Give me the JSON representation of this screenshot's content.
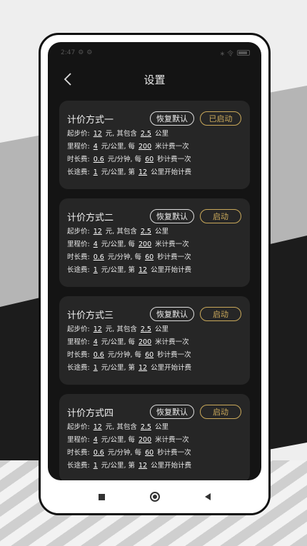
{
  "status": {
    "time": "2:47",
    "signal_text": "∗ 令"
  },
  "header": {
    "title": "设置"
  },
  "plans": [
    {
      "name": "计价方式一",
      "reset_label": "恢复默认",
      "activate_label": "已启动",
      "start_price": {
        "label": "起步价:",
        "price": "12",
        "unit": "元, 其包含",
        "km": "2.5",
        "km_unit": "公里"
      },
      "mileage": {
        "label": "里程价:",
        "price": "4",
        "unit": "元/公里, 每",
        "meters": "200",
        "meters_unit": "米计费一次"
      },
      "duration": {
        "label": "时长费:",
        "price": "0.6",
        "unit": "元/分钟, 每",
        "seconds": "60",
        "seconds_unit": "秒计费一次"
      },
      "long_distance": {
        "label": "长途费:",
        "price": "1",
        "unit": "元/公里, 第",
        "km": "12",
        "km_unit": "公里开始计费"
      }
    },
    {
      "name": "计价方式二",
      "reset_label": "恢复默认",
      "activate_label": "启动",
      "start_price": {
        "label": "起步价:",
        "price": "12",
        "unit": "元, 其包含",
        "km": "2.5",
        "km_unit": "公里"
      },
      "mileage": {
        "label": "里程价:",
        "price": "4",
        "unit": "元/公里, 每",
        "meters": "200",
        "meters_unit": "米计费一次"
      },
      "duration": {
        "label": "时长费:",
        "price": "0.6",
        "unit": "元/分钟, 每",
        "seconds": "60",
        "seconds_unit": "秒计费一次"
      },
      "long_distance": {
        "label": "长途费:",
        "price": "1",
        "unit": "元/公里, 第",
        "km": "12",
        "km_unit": "公里开始计费"
      }
    },
    {
      "name": "计价方式三",
      "reset_label": "恢复默认",
      "activate_label": "启动",
      "start_price": {
        "label": "起步价:",
        "price": "12",
        "unit": "元, 其包含",
        "km": "2.5",
        "km_unit": "公里"
      },
      "mileage": {
        "label": "里程价:",
        "price": "4",
        "unit": "元/公里, 每",
        "meters": "200",
        "meters_unit": "米计费一次"
      },
      "duration": {
        "label": "时长费:",
        "price": "0.6",
        "unit": "元/分钟, 每",
        "seconds": "60",
        "seconds_unit": "秒计费一次"
      },
      "long_distance": {
        "label": "长途费:",
        "price": "1",
        "unit": "元/公里, 第",
        "km": "12",
        "km_unit": "公里开始计费"
      }
    },
    {
      "name": "计价方式四",
      "reset_label": "恢复默认",
      "activate_label": "启动",
      "start_price": {
        "label": "起步价:",
        "price": "12",
        "unit": "元, 其包含",
        "km": "2.5",
        "km_unit": "公里"
      },
      "mileage": {
        "label": "里程价:",
        "price": "4",
        "unit": "元/公里, 每",
        "meters": "200",
        "meters_unit": "米计费一次"
      },
      "duration": {
        "label": "时长费:",
        "price": "0.6",
        "unit": "元/分钟, 每",
        "seconds": "60",
        "seconds_unit": "秒计费一次"
      },
      "long_distance": {
        "label": "长途费:",
        "price": "1",
        "unit": "元/公里, 第",
        "km": "12",
        "km_unit": "公里开始计费"
      }
    }
  ],
  "icons": {
    "back": "chevron-left-icon",
    "nav_recent": "square-icon",
    "nav_home": "circle-icon",
    "nav_back": "triangle-left-icon"
  },
  "colors": {
    "screen_bg": "#141414",
    "card_bg": "#262626",
    "accent_gold": "#c9a85a"
  }
}
